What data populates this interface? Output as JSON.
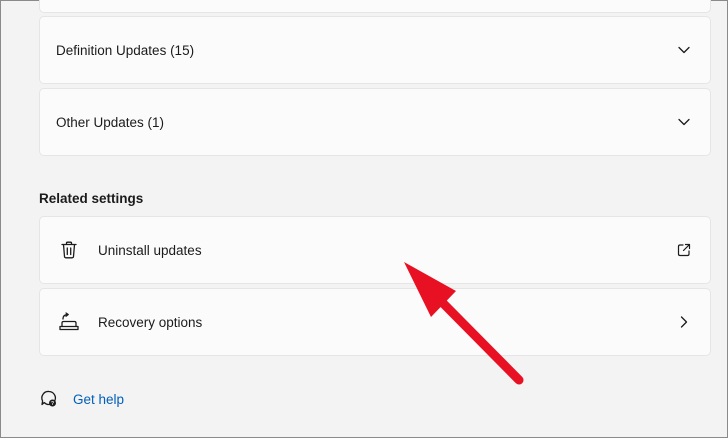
{
  "update_groups": [
    {
      "label": "Definition Updates (15)"
    },
    {
      "label": "Other Updates (1)"
    }
  ],
  "related_settings": {
    "title": "Related settings",
    "items": [
      {
        "label": "Uninstall updates",
        "icon": "trash-icon",
        "trailing_icon": "open-external-icon"
      },
      {
        "label": "Recovery options",
        "icon": "recovery-icon",
        "trailing_icon": "chevron-right-icon"
      }
    ]
  },
  "help": {
    "label": "Get help",
    "icon": "help-chat-icon"
  },
  "annotation": {
    "type": "arrow",
    "color": "#e81123"
  },
  "colors": {
    "accent_link": "#005fb8",
    "card_bg": "#fbfbfb",
    "page_bg": "#f3f3f3"
  }
}
